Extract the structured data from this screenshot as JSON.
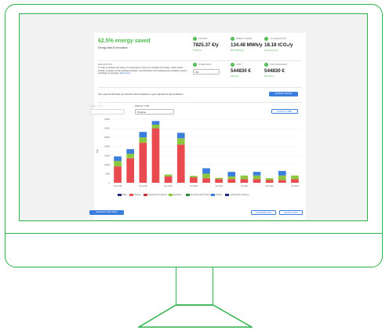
{
  "summary": {
    "headline": "62.5% energy saved",
    "subheadline": "Energy label B renovation"
  },
  "metrics": [
    {
      "label": "SAVINGS",
      "value": "7825.37 €/y",
      "sub": "8.6 €/m²y",
      "icon": "check-icon"
    },
    {
      "label": "ENERGY SAVED",
      "value": "134.48 MWh/y",
      "sub": "96.3 kWh/m²y",
      "icon": "check-icon"
    },
    {
      "label": "CO₂ REDUCTION",
      "value": "18.18 tCO₂/y",
      "sub": "13 kgCO₂/m²y",
      "icon": "check-icon"
    },
    {
      "label": "OTHER DATA",
      "value": "",
      "sub": "",
      "icon": "check-icon"
    },
    {
      "label": "COST",
      "value": "544830 €",
      "sub": "390 €/m²",
      "icon": "check-icon"
    },
    {
      "label": "COST FINANCING",
      "value": "544830 €",
      "sub": "390 €/m²y",
      "icon": "check-icon"
    }
  ],
  "description": {
    "title": "DESCRIPTION",
    "text": "In order to achieve this class, it is necessary to carry out complete renovation, which would include: insulation of the building envelope, reconstruction of the heating and ventilation system, exchange of openings.",
    "link": "Read more"
  },
  "other_data_select": {
    "value": "0%"
  },
  "experts": {
    "text": "Our experts will help you find the best solutions to your questions and problems",
    "button": "EXPERT ADVICE"
  },
  "controls": {
    "select_left_label": "SELECT LOT",
    "select_left_value": "",
    "display_type_label": "DISPLAY TYPE",
    "display_type_value": "Timeline",
    "export_button": "EXPORT LABEL"
  },
  "buttons": {
    "manage": "MANAGE TEST DATA",
    "compare": "COMPARE DATA",
    "export": "EXPORT DATA"
  },
  "colors": {
    "accent_green": "#4cb849",
    "brand_blue": "#3b7ddd",
    "monitor_outline": "#2bb24a"
  },
  "chart_data": {
    "type": "bar",
    "stacked": true,
    "ylabel": "kWh",
    "ylim": [
      0,
      35000
    ],
    "y_ticks": [
      "35000",
      "30000",
      "25000",
      "20000",
      "15000",
      "10000",
      "5000",
      "0"
    ],
    "categories": [
      "Feb 2018",
      "Nov 2018",
      "Feb 2019",
      "Jun 2019",
      "Dec 2019",
      "Jun 2020",
      "Oct 2020",
      "Mar 2021",
      "Jun 2021",
      "Jun 2022",
      "Jul 2022",
      "Oct 2022",
      "Mar 2023",
      "Jun 2023",
      "Oct 2023"
    ],
    "x_tick_labels": [
      "Feb 2018",
      "Nov 2018",
      "Feb 2019",
      "Jun 2019",
      "Dec 2019",
      "Jun 2020",
      "Oct 2020",
      "Mar 2021",
      "Jun 2021",
      "Jun 2022",
      "Jul 2022",
      "Oct 2022",
      "Mar 2023",
      "Jun 2023",
      "Oct 2023"
    ],
    "series": [
      {
        "name": "Boiler",
        "color": "#1f2a7a",
        "values": [
          0,
          0,
          0,
          0,
          0,
          0,
          0,
          0,
          0,
          0,
          0,
          0,
          0,
          0,
          0
        ]
      },
      {
        "name": "Heating",
        "color": "#e84a4f",
        "values": [
          9000,
          13500,
          22000,
          30000,
          3500,
          21000,
          3000,
          2500,
          2000,
          2000,
          2000,
          2000,
          1500,
          1500,
          2000
        ]
      },
      {
        "name": "Heating with measures",
        "color": "#c8323a",
        "values": [
          0,
          0,
          0,
          0,
          0,
          0,
          0,
          0,
          0,
          0,
          0,
          0,
          0,
          0,
          0
        ]
      },
      {
        "name": "Electricity",
        "color": "#8cc63f",
        "values": [
          3000,
          2500,
          3000,
          2000,
          1000,
          3500,
          800,
          2500,
          700,
          1500,
          2000,
          2000,
          1000,
          2500,
          2000
        ]
      },
      {
        "name": "Electricity with measures",
        "color": "#2e8b3a",
        "values": [
          0,
          0,
          0,
          0,
          0,
          0,
          0,
          0,
          0,
          0,
          0,
          0,
          0,
          0,
          0
        ]
      },
      {
        "name": "Cooling",
        "color": "#3b7ddd",
        "values": [
          2500,
          2500,
          3000,
          2000,
          0,
          3000,
          0,
          3000,
          0,
          2500,
          0,
          2000,
          0,
          2500,
          0
        ]
      },
      {
        "name": "Cooling with measures",
        "color": "#1f2a7a",
        "values": [
          0,
          0,
          0,
          0,
          0,
          0,
          0,
          0,
          0,
          0,
          0,
          0,
          0,
          0,
          0
        ]
      }
    ],
    "legend_position": "bottom",
    "grid": true
  }
}
